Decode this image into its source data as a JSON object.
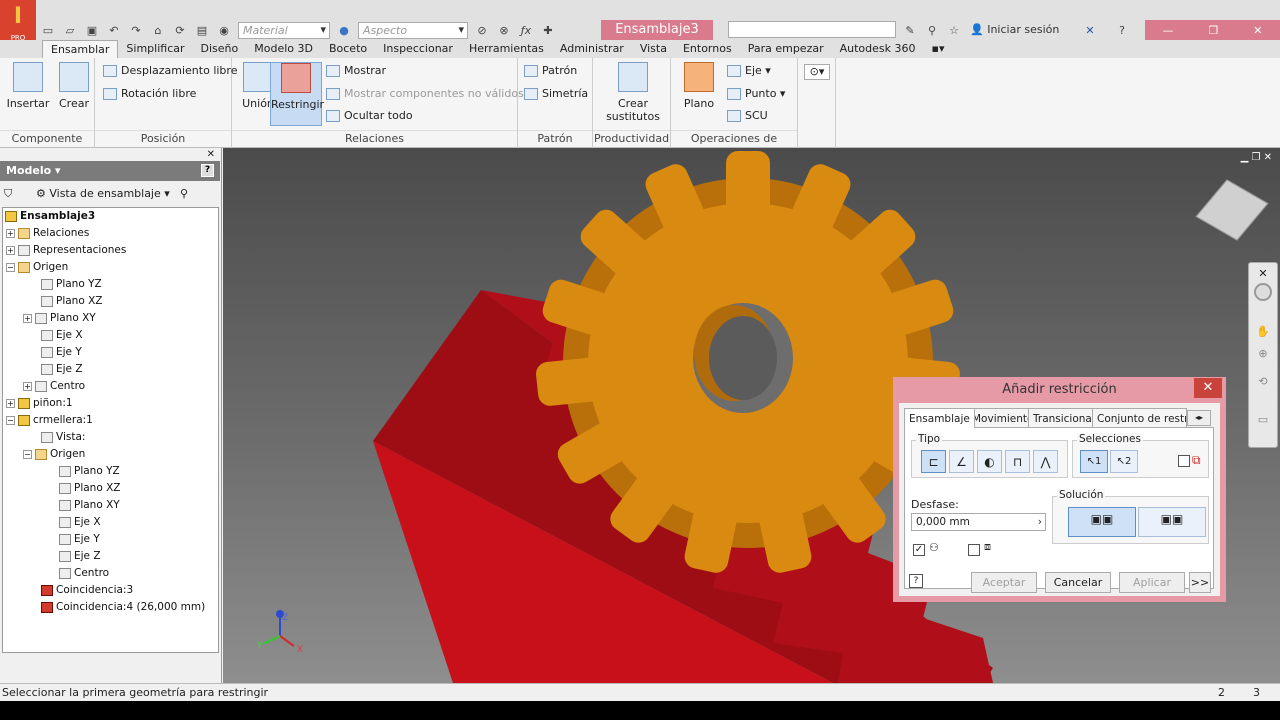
{
  "app": {
    "logo_letter": "I",
    "logo_sub": "PRO"
  },
  "qat": {
    "material_placeholder": "Material",
    "appearance_placeholder": "Aspecto"
  },
  "document": {
    "title": "Ensamblaje3"
  },
  "header": {
    "signin": "Iniciar sesión"
  },
  "ribbon_tabs": [
    "Ensamblar",
    "Simplificar",
    "Diseño",
    "Modelo 3D",
    "Boceto",
    "Inspeccionar",
    "Herramientas",
    "Administrar",
    "Vista",
    "Entornos",
    "Para empezar",
    "Autodesk 360"
  ],
  "ribbon": {
    "insertar": "Insertar",
    "crear": "Crear",
    "componente": "Componente",
    "desplazamiento_libre": "Desplazamiento libre",
    "rotacion_libre": "Rotación libre",
    "posicion": "Posición",
    "union": "Unión",
    "restringir": "Restringir",
    "mostrar": "Mostrar",
    "mostrar_componentes": "Mostrar componentes no válidos",
    "ocultar_todo": "Ocultar todo",
    "relaciones": "Relaciones",
    "patron": "Patrón",
    "simetria": "Simetría",
    "patron_panel": "Patrón",
    "crear_sustitutos": "Crear sustitutos",
    "productividad": "Productividad",
    "plano": "Plano",
    "eje": "Eje",
    "punto": "Punto",
    "scu": "SCU",
    "operaciones_trabajo": "Operaciones de trabajo"
  },
  "browser": {
    "title": "Modelo",
    "view": "Vista de ensamblaje",
    "tree": [
      "Ensamblaje3",
      "Relaciones",
      "Representaciones",
      "Origen",
      "Plano YZ",
      "Plano XZ",
      "Plano XY",
      "Eje X",
      "Eje Y",
      "Eje Z",
      "Centro",
      "piñon:1",
      "crmellera:1",
      "Vista:",
      "Origen",
      "Plano YZ",
      "Plano XZ",
      "Plano XY",
      "Eje X",
      "Eje Y",
      "Eje Z",
      "Centro",
      "Coincidencia:3",
      "Coincidencia:4 (26,000 mm)"
    ]
  },
  "dialog": {
    "title": "Añadir restricción",
    "tabs": [
      "Ensamblaje",
      "Movimiento",
      "Transicional",
      "Conjunto de restric"
    ],
    "tipo": "Tipo",
    "selecciones": "Selecciones",
    "sel1": "1",
    "sel2": "2",
    "desfase_label": "Desfase:",
    "desfase_value": "0,000 mm",
    "solucion": "Solución",
    "aceptar": "Aceptar",
    "cancelar": "Cancelar",
    "aplicar": "Aplicar",
    "more": ">>",
    "help": "?"
  },
  "axis_labels": {
    "x": "X",
    "y": "Y",
    "z": "Z"
  },
  "status": {
    "text": "Seleccionar la primera geometría para restringir",
    "n1": "2",
    "n2": "3"
  },
  "colors": {
    "rack": "#c8101b",
    "gear": "#d98a10",
    "accent": "#e59aa6"
  }
}
